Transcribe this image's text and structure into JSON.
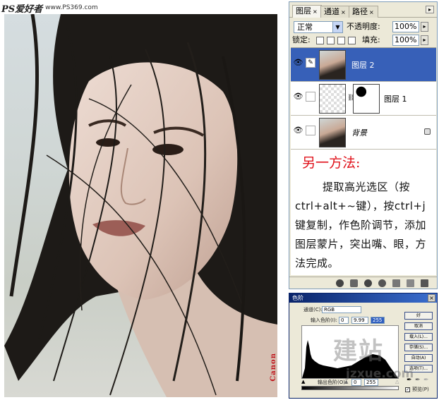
{
  "site": {
    "logo": "PS爱好者",
    "url": "www.PS369.com"
  },
  "photo": {
    "brand": "Canon"
  },
  "layers_panel": {
    "tabs": [
      {
        "label": "图层"
      },
      {
        "label": "通道"
      },
      {
        "label": "路径"
      }
    ],
    "blend_mode": "正常",
    "opacity_label": "不透明度:",
    "opacity_value": "100%",
    "lock_label": "锁定:",
    "fill_label": "填充:",
    "fill_value": "100%",
    "layers": [
      {
        "name": "图层 2",
        "selected": true
      },
      {
        "name": "图层 1",
        "selected": false
      },
      {
        "name": "背景",
        "selected": false
      }
    ]
  },
  "note": {
    "heading": "另一方法:",
    "body": "提取高光选区（按ctrl+alt+~键），按ctrl+j键复制，作色阶调节，添加图层蒙片，突出嘴、眼，方法完成。"
  },
  "levels_dialog": {
    "title": "色阶",
    "channel_label": "通道(C):",
    "channel_value": "RGB",
    "input_label": "输入色阶(I):",
    "input_values": [
      "0",
      "9.99",
      "255"
    ],
    "output_label": "输出色阶(O):",
    "output_values": [
      "0",
      "255"
    ],
    "buttons": [
      "好",
      "取消",
      "载入(L)...",
      "存储(S)...",
      "自动(A)",
      "选项(T)..."
    ],
    "preview_label": "预览(P)"
  },
  "watermark": {
    "top": "建站",
    "bottom": "jzxue.com"
  },
  "colors": {
    "selected_layer": "#3760b8",
    "note_heading": "#e0121b",
    "panel_bg": "#ece9d8"
  }
}
